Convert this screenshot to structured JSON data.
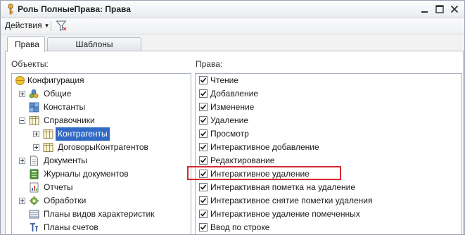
{
  "window": {
    "title": "Роль ПолныеПрава: Права",
    "colors": {
      "accent": "#316ac5",
      "highlight": "#d42a2f"
    }
  },
  "toolbar": {
    "actions_label": "Действия",
    "filter_icon": "funnel-icon"
  },
  "tabs": [
    {
      "label": "Права",
      "active": true
    },
    {
      "label": "Шаблоны ограничений",
      "active": false
    }
  ],
  "left_pane": {
    "label": "Объекты:",
    "items": [
      {
        "label": "Конфигурация",
        "icon": "configuration-icon",
        "level": 0,
        "expander": "none"
      },
      {
        "label": "Общие",
        "icon": "common-icon",
        "level": 1,
        "expander": "plus"
      },
      {
        "label": "Константы",
        "icon": "constants-icon",
        "level": 1,
        "expander": "none"
      },
      {
        "label": "Справочники",
        "icon": "catalog-icon",
        "level": 1,
        "expander": "minus"
      },
      {
        "label": "Контрагенты",
        "icon": "catalog-icon",
        "level": 2,
        "expander": "plus",
        "selected": true
      },
      {
        "label": "ДоговорыКонтрагентов",
        "icon": "catalog-icon",
        "level": 2,
        "expander": "plus"
      },
      {
        "label": "Документы",
        "icon": "document-icon",
        "level": 1,
        "expander": "plus"
      },
      {
        "label": "Журналы документов",
        "icon": "journal-icon",
        "level": 1,
        "expander": "none"
      },
      {
        "label": "Отчеты",
        "icon": "report-icon",
        "level": 1,
        "expander": "none"
      },
      {
        "label": "Обработки",
        "icon": "processing-icon",
        "level": 1,
        "expander": "plus"
      },
      {
        "label": "Планы видов характеристик",
        "icon": "characteristics-icon",
        "level": 1,
        "expander": "none"
      },
      {
        "label": "Планы счетов",
        "icon": "accounts-icon",
        "level": 1,
        "expander": "none"
      }
    ]
  },
  "right_pane": {
    "label": "Права:",
    "items": [
      {
        "label": "Чтение",
        "checked": true
      },
      {
        "label": "Добавление",
        "checked": true
      },
      {
        "label": "Изменение",
        "checked": true
      },
      {
        "label": "Удаление",
        "checked": true
      },
      {
        "label": "Просмотр",
        "checked": true
      },
      {
        "label": "Интерактивное добавление",
        "checked": true
      },
      {
        "label": "Редактирование",
        "checked": true
      },
      {
        "label": "Интерактивное удаление",
        "checked": true,
        "highlighted": true
      },
      {
        "label": "Интерактивная пометка на удаление",
        "checked": true
      },
      {
        "label": "Интерактивное снятие пометки удаления",
        "checked": true
      },
      {
        "label": "Интерактивное удаление помеченных",
        "checked": true
      },
      {
        "label": "Ввод по строке",
        "checked": true
      }
    ]
  }
}
